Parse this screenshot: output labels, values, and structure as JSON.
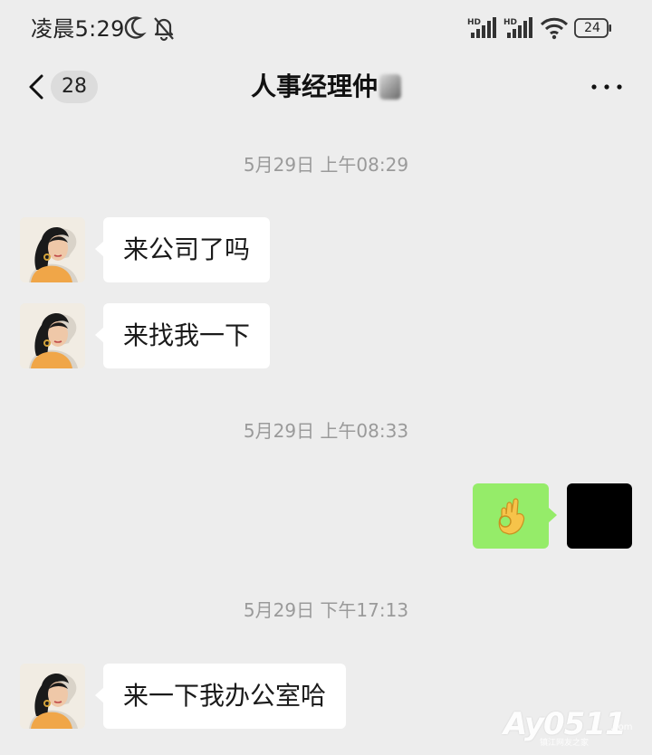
{
  "status_bar": {
    "time": "凌晨5:29",
    "icons": [
      "moon-icon",
      "mute-bell-icon",
      "hd-signal-icon",
      "hd-signal-icon",
      "wifi-icon",
      "battery-icon"
    ],
    "battery": "24"
  },
  "nav": {
    "back_icon": "chevron-left-icon",
    "unread_count": "28",
    "title": "人事经理仲",
    "more_icon": "more-dots-icon"
  },
  "messages": [
    {
      "kind": "timestamp",
      "text": "5月29日 上午08:29"
    },
    {
      "kind": "incoming",
      "text": "来公司了吗"
    },
    {
      "kind": "incoming",
      "text": "来找我一下"
    },
    {
      "kind": "timestamp",
      "text": "5月29日 上午08:33"
    },
    {
      "kind": "outgoing",
      "text": "👌",
      "emoji_name": "ok-hand-emoji"
    },
    {
      "kind": "timestamp",
      "text": "5月29日 下午17:13"
    },
    {
      "kind": "incoming",
      "text": "来一下我办公室哈"
    }
  ],
  "colors": {
    "background": "#ededed",
    "outgoing_bubble": "#95ec69",
    "incoming_bubble": "#ffffff",
    "timestamp_text": "#9a9a9a"
  },
  "watermark": {
    "main": "Ay0511",
    "domain": ".com",
    "sub": "镇江网友之家"
  }
}
